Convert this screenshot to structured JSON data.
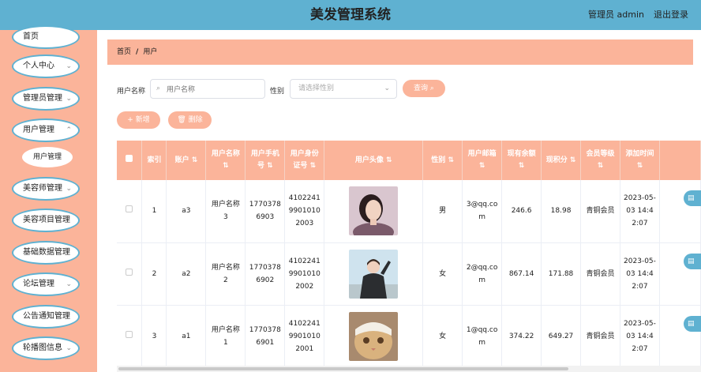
{
  "app": {
    "title": "美发管理系统",
    "user": "管理员 admin",
    "logout": "退出登录"
  },
  "sidebar": {
    "items": [
      {
        "label": "首页",
        "has_chevron": false
      },
      {
        "label": "个人中心",
        "has_chevron": true
      },
      {
        "label": "管理员管理",
        "has_chevron": true
      },
      {
        "label": "用户管理",
        "has_chevron": true
      },
      {
        "label": "美容师管理",
        "has_chevron": true
      },
      {
        "label": "美容项目管理",
        "has_chevron": false
      },
      {
        "label": "基础数据管理",
        "has_chevron": false
      },
      {
        "label": "论坛管理",
        "has_chevron": true
      },
      {
        "label": "公告通知管理",
        "has_chevron": false
      },
      {
        "label": "轮播图信息",
        "has_chevron": true
      }
    ],
    "sub_item": "用户管理"
  },
  "breadcrumb": {
    "home": "首页",
    "separator": "/",
    "current": "用户"
  },
  "search": {
    "name_label": "用户名称",
    "name_placeholder": "用户名称",
    "gender_label": "性别",
    "gender_placeholder": "请选择性别",
    "query_button": "查询"
  },
  "actions": {
    "add": "新增",
    "delete": "删除"
  },
  "table": {
    "headers": [
      "索引",
      "账户",
      "用户名称",
      "用户手机号",
      "用户身份证号",
      "用户头像",
      "性别",
      "用户邮箱",
      "现有余额",
      "现积分",
      "会员等级",
      "添加时间"
    ],
    "rows": [
      {
        "index": "1",
        "account": "a3",
        "name": "用户名称3",
        "phone": "17703786903",
        "id_card": "410224199010102003",
        "gender": "男",
        "email": "3@qq.com",
        "balance": "246.6",
        "points": "18.98",
        "level": "青铜会员",
        "time": "2023-05-03 14:42:07"
      },
      {
        "index": "2",
        "account": "a2",
        "name": "用户名称2",
        "phone": "17703786902",
        "id_card": "410224199010102002",
        "gender": "女",
        "email": "2@qq.com",
        "balance": "867.14",
        "points": "171.88",
        "level": "青铜会员",
        "time": "2023-05-03 14:42:07"
      },
      {
        "index": "3",
        "account": "a1",
        "name": "用户名称1",
        "phone": "17703786901",
        "id_card": "410224199010102001",
        "gender": "女",
        "email": "1@qq.com",
        "balance": "374.22",
        "points": "649.27",
        "level": "青铜会员",
        "time": "2023-05-03 14:42:07"
      }
    ]
  },
  "colors": {
    "header": "#5fb1d1",
    "sidebar": "#fbb49a",
    "accent": "#fbb49a"
  }
}
